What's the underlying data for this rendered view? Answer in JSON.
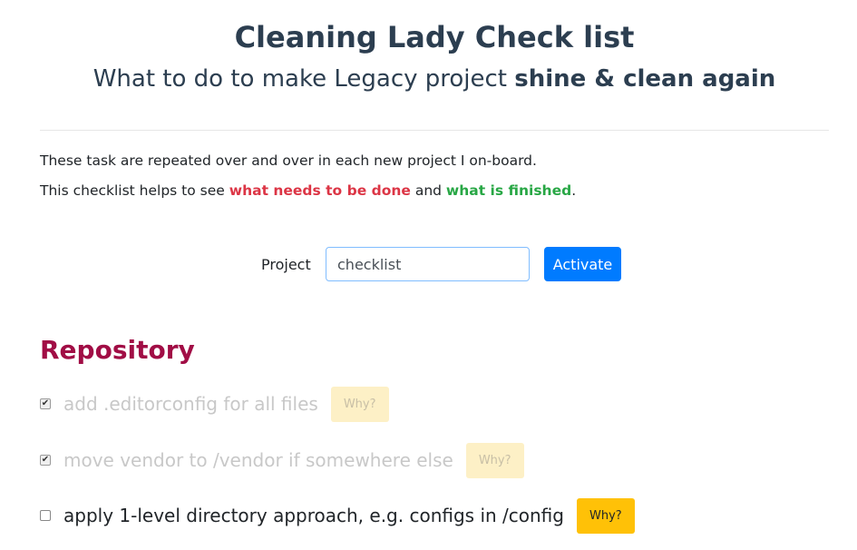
{
  "header": {
    "title": "Cleaning Lady Check list",
    "subtitle_prefix": "What to do to make Legacy project ",
    "subtitle_bold": "shine & clean again"
  },
  "intro": {
    "line1": "These task are repeated over and over in each new project I on-board.",
    "line2_prefix": "This checklist helps to see ",
    "line2_red": "what needs to be done",
    "line2_mid": " and ",
    "line2_green": "what is finished",
    "line2_suffix": "."
  },
  "project_form": {
    "label": "Project",
    "input_value": "checklist",
    "button_label": "Activate"
  },
  "sections": [
    {
      "title": "Repository",
      "items": [
        {
          "label": "add .editorconfig for all files",
          "checked": true,
          "why_label": "Why?"
        },
        {
          "label": "move vendor to /vendor if somewhere else",
          "checked": true,
          "why_label": "Why?"
        },
        {
          "label": "apply 1-level directory approach, e.g. configs in /config",
          "checked": false,
          "why_label": "Why?"
        }
      ]
    }
  ],
  "colors": {
    "accent_blue": "#007bff",
    "section_title": "#a10d45",
    "todo_red": "#dc3545",
    "done_green": "#28a745",
    "why_yellow": "#ffc107"
  },
  "icons": [
    "checkbox-checked-icon",
    "checkbox-unchecked-icon"
  ]
}
